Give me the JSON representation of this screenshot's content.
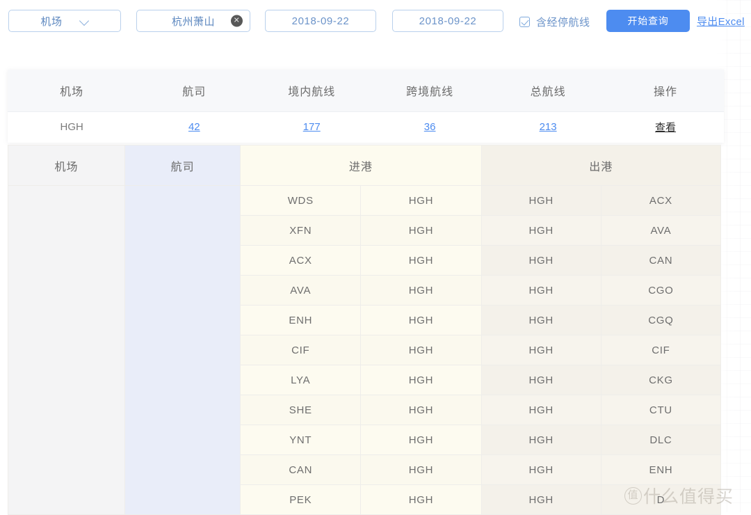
{
  "toolbar": {
    "airport_select_label": "机场",
    "airport_select_icon": "chevron-down-icon",
    "selected_tag": "杭州萧山",
    "clear_icon": "close-circle-icon",
    "date_start": "2018-09-22",
    "date_end": "2018-09-22",
    "checkbox_label": "含经停航线",
    "checkbox_checked": true,
    "query_button": "开始查询",
    "export_link": "导出Excel",
    "accent_color": "#4d8cf0",
    "link_color": "#6b93c9"
  },
  "summary": {
    "headers": [
      "机场",
      "航司",
      "境内航线",
      "跨境航线",
      "总航线",
      "操作"
    ],
    "row": {
      "airport": "HGH",
      "carriers": "42",
      "domestic_routes": "177",
      "cross_border_routes": "36",
      "total_routes": "213",
      "action": "查看"
    }
  },
  "detail": {
    "headers": {
      "airport": "机场",
      "carrier": "航司",
      "arrival": "进港",
      "departure": "出港"
    },
    "airport_cell": "",
    "carrier_cell": "",
    "rows": [
      {
        "arr_from": "WDS",
        "arr_to": "HGH",
        "dep_from": "HGH",
        "dep_to": "ACX"
      },
      {
        "arr_from": "XFN",
        "arr_to": "HGH",
        "dep_from": "HGH",
        "dep_to": "AVA"
      },
      {
        "arr_from": "ACX",
        "arr_to": "HGH",
        "dep_from": "HGH",
        "dep_to": "CAN"
      },
      {
        "arr_from": "AVA",
        "arr_to": "HGH",
        "dep_from": "HGH",
        "dep_to": "CGO"
      },
      {
        "arr_from": "ENH",
        "arr_to": "HGH",
        "dep_from": "HGH",
        "dep_to": "CGQ"
      },
      {
        "arr_from": "CIF",
        "arr_to": "HGH",
        "dep_from": "HGH",
        "dep_to": "CIF"
      },
      {
        "arr_from": "LYA",
        "arr_to": "HGH",
        "dep_from": "HGH",
        "dep_to": "CKG"
      },
      {
        "arr_from": "SHE",
        "arr_to": "HGH",
        "dep_from": "HGH",
        "dep_to": "CTU"
      },
      {
        "arr_from": "YNT",
        "arr_to": "HGH",
        "dep_from": "HGH",
        "dep_to": "DLC"
      },
      {
        "arr_from": "CAN",
        "arr_to": "HGH",
        "dep_from": "HGH",
        "dep_to": "ENH"
      },
      {
        "arr_from": "PEK",
        "arr_to": "HGH",
        "dep_from": "HGH",
        "dep_to": "D"
      }
    ]
  },
  "watermark": {
    "badge": "值",
    "text": "什么值得买"
  }
}
